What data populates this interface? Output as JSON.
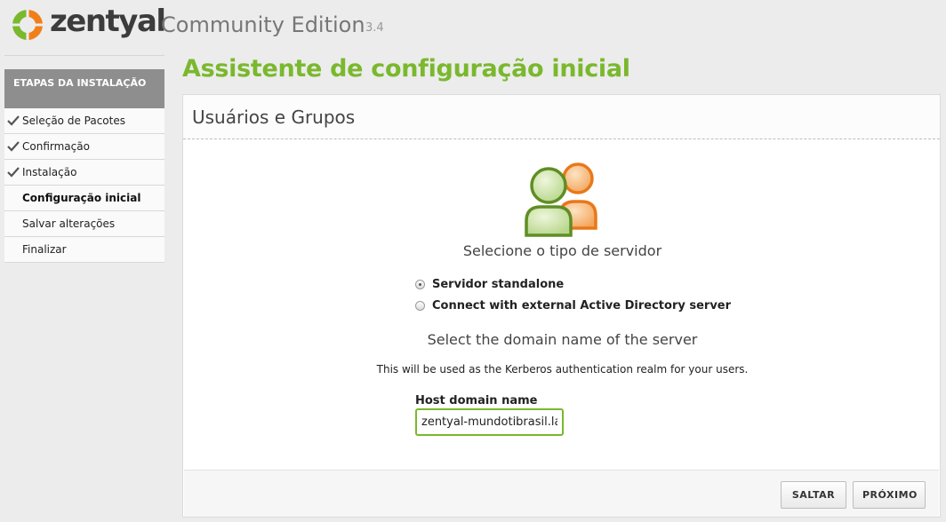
{
  "header": {
    "brand": "zentyal",
    "edition": "Community Edition",
    "version": "3.4"
  },
  "sidebar": {
    "title": "ETAPAS DA INSTALAÇÃO",
    "steps": [
      {
        "label": "Seleção de Pacotes",
        "status": "done"
      },
      {
        "label": "Confirmação",
        "status": "done"
      },
      {
        "label": "Instalação",
        "status": "done"
      },
      {
        "label": "Configuração inicial",
        "status": "current"
      },
      {
        "label": "Salvar alterações",
        "status": "pending"
      },
      {
        "label": "Finalizar",
        "status": "pending"
      }
    ]
  },
  "main": {
    "page_title": "Assistente de configuração inicial",
    "panel_title": "Usuários e Grupos",
    "icon": "users-group-icon",
    "server_type_heading": "Selecione o tipo de servidor",
    "server_options": [
      {
        "label": "Servidor standalone",
        "checked": true
      },
      {
        "label": "Connect with external Active Directory server",
        "checked": false
      }
    ],
    "domain_heading": "Select the domain name of the server",
    "domain_description": "This will be used as the Kerberos authentication realm for your users.",
    "host_label": "Host domain name",
    "host_value": "zentyal-mundotibrasil.lan",
    "skip_label": "SALTAR",
    "next_label": "PRÓXIMO"
  },
  "colors": {
    "accent_green": "#7ab82d",
    "accent_orange": "#f07f1a",
    "sidebar_header": "#8e8e8e"
  }
}
